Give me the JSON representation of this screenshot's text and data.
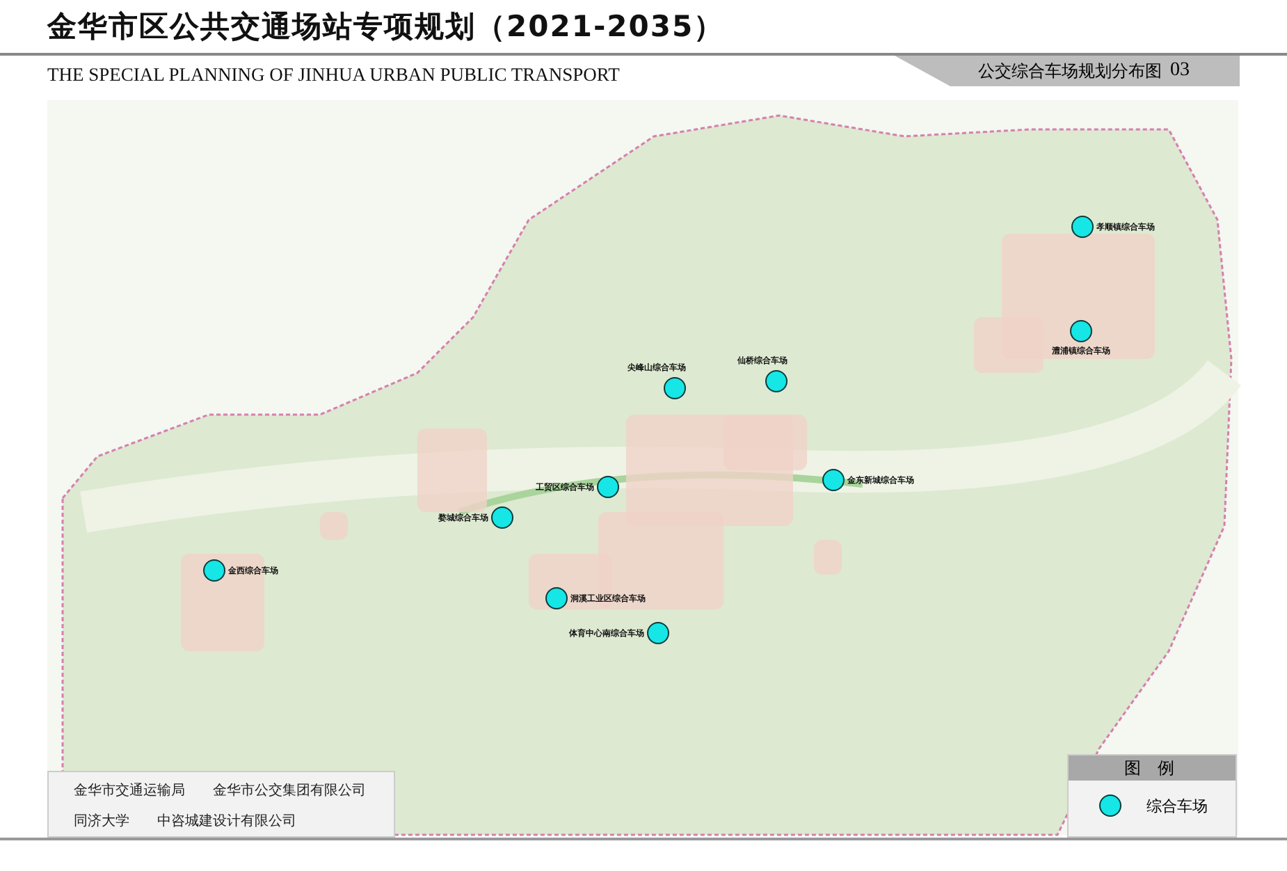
{
  "header": {
    "title": "金华市区公共交通场站专项规划（2021-2035）",
    "subtitle": "THE SPECIAL PLANNING OF JINHUA URBAN PUBLIC TRANSPORT",
    "sheet_title": "公交综合车场规划分布图",
    "sheet_number": "03"
  },
  "map": {
    "stations": [
      {
        "name": "孝顺镇综合车场"
      },
      {
        "name": "澧浦镇综合车场"
      },
      {
        "name": "尖峰山综合车场"
      },
      {
        "name": "仙桥综合车场"
      },
      {
        "name": "工贸区综合车场"
      },
      {
        "name": "金东新城综合车场"
      },
      {
        "name": "婺城综合车场"
      },
      {
        "name": "金西综合车场"
      },
      {
        "name": "洞溪工业区综合车场"
      },
      {
        "name": "体育中心南综合车场"
      }
    ]
  },
  "credits": [
    [
      "金华市交通运输局",
      "金华市公交集团有限公司"
    ],
    [
      "同济大学",
      "中咨城建设计有限公司"
    ]
  ],
  "legend": {
    "title": "图 例",
    "items": [
      {
        "label": "综合车场"
      }
    ]
  }
}
